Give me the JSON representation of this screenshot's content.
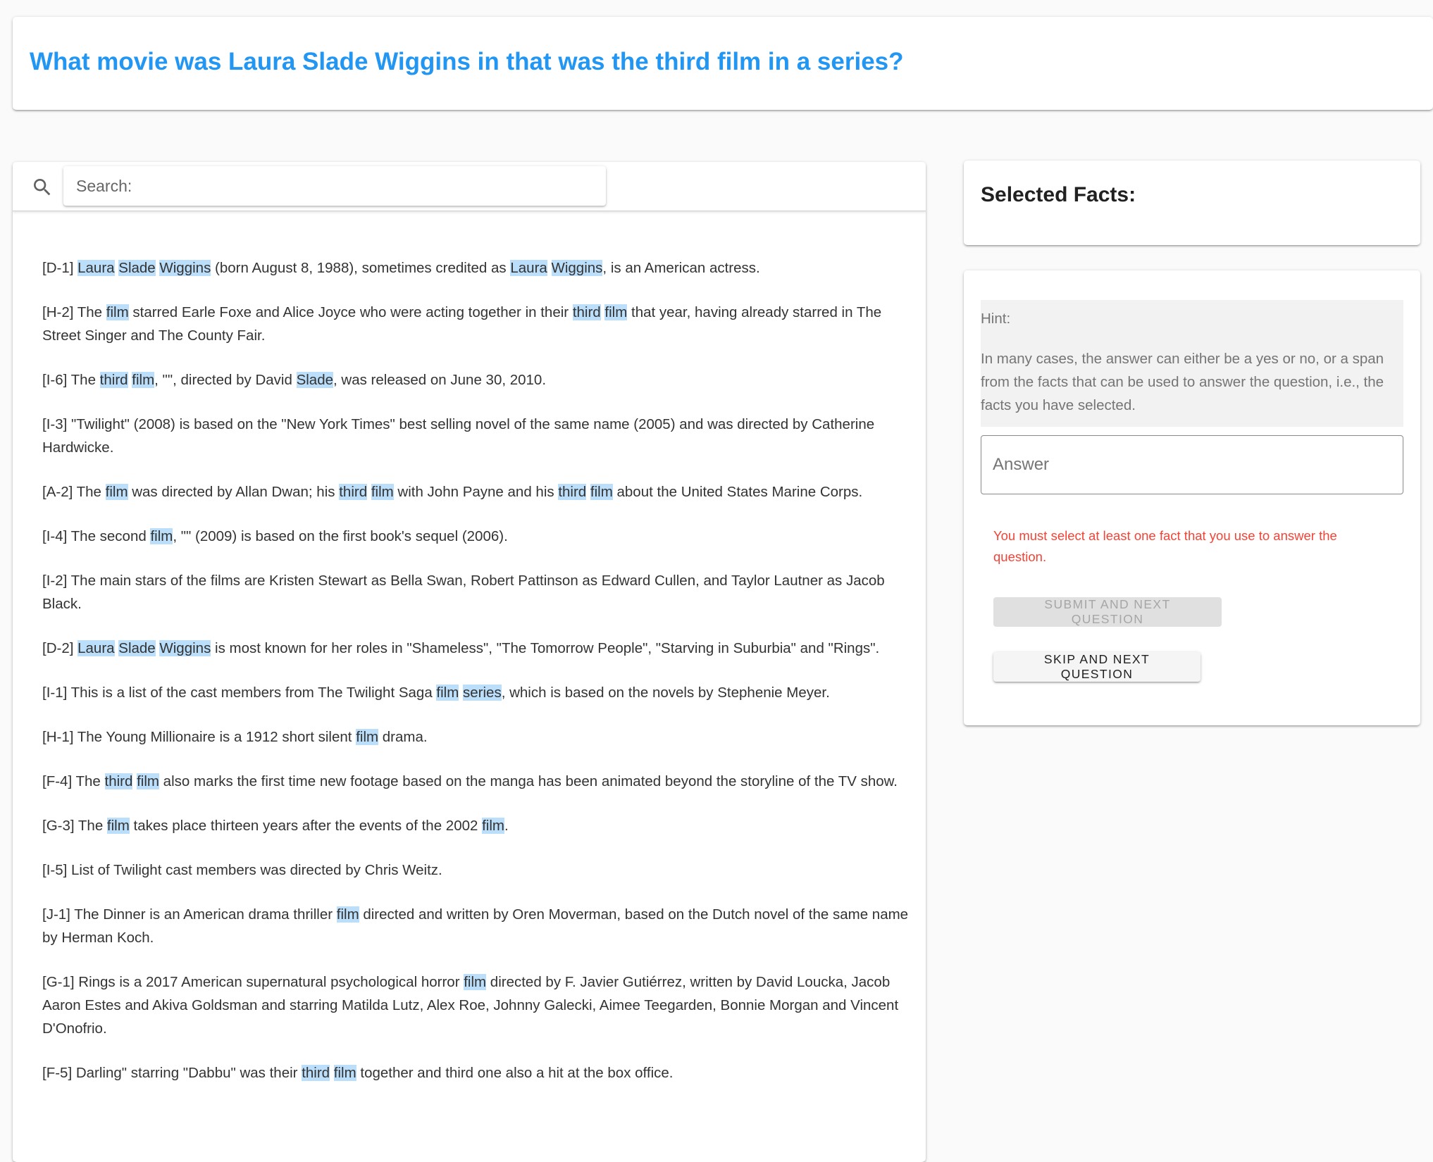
{
  "question": {
    "text": "What movie was Laura Slade Wiggins in that was the third film in a series?"
  },
  "search": {
    "placeholder": "Search:"
  },
  "facts": [
    {
      "id": "D-1",
      "segments": [
        {
          "t": "[D-1] "
        },
        {
          "t": "Laura",
          "hl": true
        },
        {
          "t": " "
        },
        {
          "t": "Slade",
          "hl": true
        },
        {
          "t": " "
        },
        {
          "t": "Wiggins",
          "hl": true
        },
        {
          "t": " (born August 8, 1988), sometimes credited as "
        },
        {
          "t": "Laura",
          "hl": true
        },
        {
          "t": " "
        },
        {
          "t": "Wiggins",
          "hl": true
        },
        {
          "t": ", is an American actress."
        }
      ]
    },
    {
      "id": "H-2",
      "segments": [
        {
          "t": "[H-2] The "
        },
        {
          "t": "film",
          "hl": true
        },
        {
          "t": " starred Earle Foxe and Alice Joyce who were acting together in their "
        },
        {
          "t": "third",
          "hl": true
        },
        {
          "t": " "
        },
        {
          "t": "film",
          "hl": true
        },
        {
          "t": " that year, having already starred in The Street Singer and The County Fair."
        }
      ]
    },
    {
      "id": "I-6",
      "segments": [
        {
          "t": "[I-6] The "
        },
        {
          "t": "third",
          "hl": true
        },
        {
          "t": " "
        },
        {
          "t": "film",
          "hl": true
        },
        {
          "t": ", \"\", directed by David "
        },
        {
          "t": "Slade",
          "hl": true
        },
        {
          "t": ", was released on June 30, 2010."
        }
      ]
    },
    {
      "id": "I-3",
      "segments": [
        {
          "t": "[I-3] \"Twilight\" (2008) is based on the \"New York Times\" best selling novel of the same name (2005) and was directed by Catherine Hardwicke."
        }
      ]
    },
    {
      "id": "A-2",
      "segments": [
        {
          "t": "[A-2] The "
        },
        {
          "t": "film",
          "hl": true
        },
        {
          "t": " was directed by Allan Dwan; his "
        },
        {
          "t": "third",
          "hl": true
        },
        {
          "t": " "
        },
        {
          "t": "film",
          "hl": true
        },
        {
          "t": " with John Payne and his "
        },
        {
          "t": "third",
          "hl": true
        },
        {
          "t": " "
        },
        {
          "t": "film",
          "hl": true
        },
        {
          "t": " about the United States Marine Corps."
        }
      ]
    },
    {
      "id": "I-4",
      "segments": [
        {
          "t": "[I-4] The second "
        },
        {
          "t": "film",
          "hl": true
        },
        {
          "t": ", \"\" (2009) is based on the first book's sequel (2006)."
        }
      ]
    },
    {
      "id": "I-2",
      "segments": [
        {
          "t": "[I-2] The main stars of the films are Kristen Stewart as Bella Swan, Robert Pattinson as Edward Cullen, and Taylor Lautner as Jacob Black."
        }
      ]
    },
    {
      "id": "D-2",
      "segments": [
        {
          "t": "[D-2] "
        },
        {
          "t": "Laura",
          "hl": true
        },
        {
          "t": " "
        },
        {
          "t": "Slade",
          "hl": true
        },
        {
          "t": " "
        },
        {
          "t": "Wiggins",
          "hl": true
        },
        {
          "t": " is most known for her roles in \"Shameless\", \"The Tomorrow People\", \"Starving in Suburbia\" and \"Rings\"."
        }
      ]
    },
    {
      "id": "I-1",
      "segments": [
        {
          "t": "[I-1] This is a list of the cast members from The Twilight Saga "
        },
        {
          "t": "film",
          "hl": true
        },
        {
          "t": " "
        },
        {
          "t": "series",
          "hl": true
        },
        {
          "t": ", which is based on the novels by Stephenie Meyer."
        }
      ]
    },
    {
      "id": "H-1",
      "segments": [
        {
          "t": "[H-1] The Young Millionaire is a 1912 short silent "
        },
        {
          "t": "film",
          "hl": true
        },
        {
          "t": " drama."
        }
      ]
    },
    {
      "id": "F-4",
      "segments": [
        {
          "t": "[F-4] The "
        },
        {
          "t": "third",
          "hl": true
        },
        {
          "t": " "
        },
        {
          "t": "film",
          "hl": true
        },
        {
          "t": " also marks the first time new footage based on the manga has been animated beyond the storyline of the TV show."
        }
      ]
    },
    {
      "id": "G-3",
      "segments": [
        {
          "t": "[G-3] The "
        },
        {
          "t": "film",
          "hl": true
        },
        {
          "t": " takes place thirteen years after the events of the 2002 "
        },
        {
          "t": "film",
          "hl": true
        },
        {
          "t": "."
        }
      ]
    },
    {
      "id": "I-5",
      "segments": [
        {
          "t": "[I-5] List of Twilight cast members was directed by Chris Weitz."
        }
      ]
    },
    {
      "id": "J-1",
      "segments": [
        {
          "t": "[J-1] The Dinner is an American drama thriller "
        },
        {
          "t": "film",
          "hl": true
        },
        {
          "t": " directed and written by Oren Moverman, based on the Dutch novel of the same name by Herman Koch."
        }
      ]
    },
    {
      "id": "G-1",
      "segments": [
        {
          "t": "[G-1] Rings is a 2017 American supernatural psychological horror "
        },
        {
          "t": "film",
          "hl": true
        },
        {
          "t": " directed by F. Javier Gutiérrez, written by David Loucka, Jacob Aaron Estes and Akiva Goldsman and starring Matilda Lutz, Alex Roe, Johnny Galecki, Aimee Teegarden, Bonnie Morgan and Vincent D'Onofrio."
        }
      ]
    },
    {
      "id": "F-5",
      "segments": [
        {
          "t": "[F-5] Darling\" starring \"Dabbu\" was their "
        },
        {
          "t": "third",
          "hl": true
        },
        {
          "t": " "
        },
        {
          "t": "film",
          "hl": true
        },
        {
          "t": " together and third one also a hit at the box office."
        }
      ]
    }
  ],
  "selected_facts": {
    "title": "Selected Facts:"
  },
  "hint": {
    "label": "Hint:",
    "text": "In many cases, the answer can either be a yes or no, or a span from the facts that can be used to answer the question, i.e., the facts you have selected."
  },
  "answer": {
    "placeholder": "Answer",
    "value": ""
  },
  "error": {
    "text": "You must select at least one fact that you use to answer the question."
  },
  "buttons": {
    "submit_label": "Submit and next question",
    "skip_label": "Skip and next question"
  },
  "icons": {
    "search": "search-icon"
  },
  "colors": {
    "question": "#2196f3",
    "highlight": "#bbdefb",
    "error": "#f44336"
  }
}
